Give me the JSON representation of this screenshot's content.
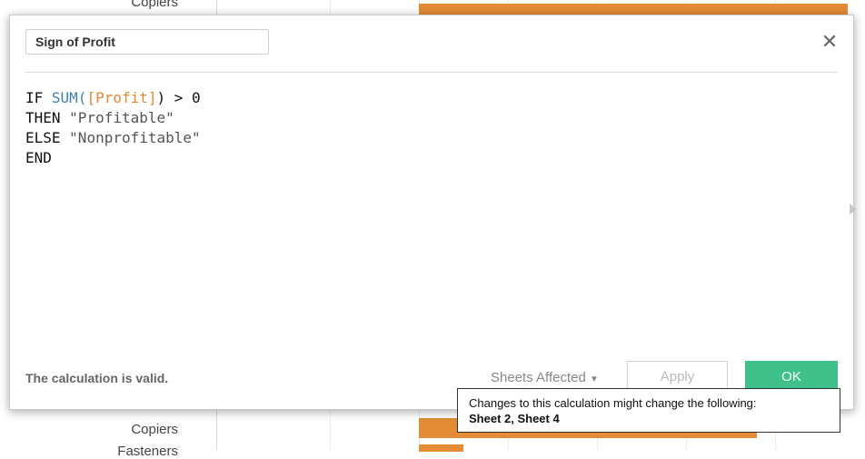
{
  "background": {
    "top_label": "Copiers",
    "bottom_labels": [
      "Copiers",
      "Fasteners"
    ]
  },
  "dialog": {
    "calc_name": "Sign of Profit",
    "close_icon": "close-icon",
    "formula": {
      "line1": {
        "kw": "IF ",
        "fn": "SUM(",
        "field": "[Profit]",
        "rest": ") > 0"
      },
      "line2": {
        "kw": "THEN ",
        "str": "\"Profitable\""
      },
      "line3": {
        "kw": "ELSE ",
        "str": "\"Nonprofitable\""
      },
      "line4": {
        "kw": "END"
      }
    },
    "status": "The calculation is valid.",
    "sheets_affected": "Sheets Affected",
    "apply_label": "Apply",
    "ok_label": "OK"
  },
  "tooltip": {
    "line1": "Changes to this calculation might change the following:",
    "line2": "Sheet 2, Sheet 4"
  },
  "colors": {
    "bar": "#e38b35",
    "ok": "#40c08a",
    "function": "#3d7fb5",
    "field": "#e3882e"
  }
}
